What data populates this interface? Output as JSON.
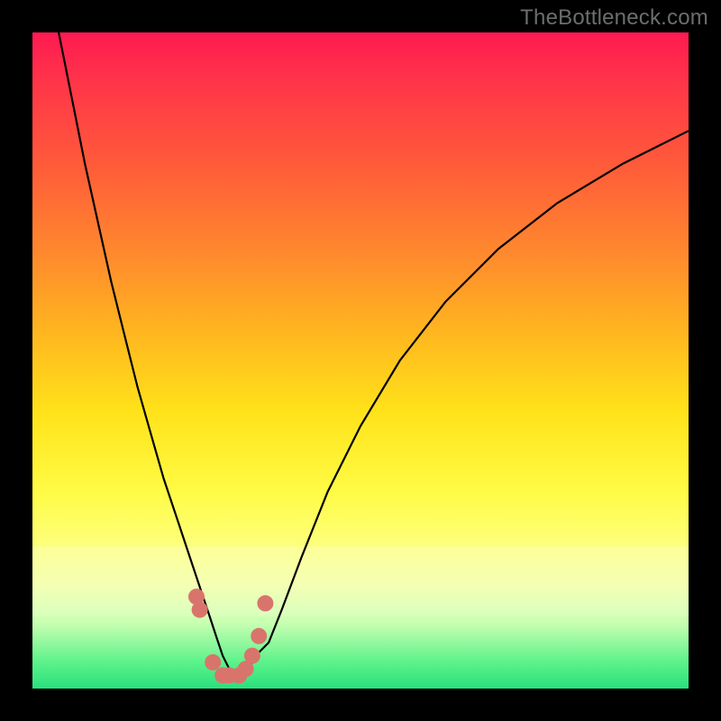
{
  "watermark": "TheBottleneck.com",
  "chart_data": {
    "type": "line",
    "title": "",
    "xlabel": "",
    "ylabel": "",
    "xlim": [
      0,
      100
    ],
    "ylim": [
      0,
      100
    ],
    "series": [
      {
        "name": "bottleneck-curve",
        "x": [
          4,
          6,
          8,
          10,
          12,
          14,
          16,
          18,
          20,
          22,
          24,
          26,
          27,
          28,
          29,
          30,
          31,
          32,
          33,
          34,
          36,
          38,
          41,
          45,
          50,
          56,
          63,
          71,
          80,
          90,
          100
        ],
        "values": [
          100,
          90,
          80,
          71,
          62,
          54,
          46,
          39,
          32,
          26,
          20,
          14,
          11,
          8,
          5,
          3,
          2,
          2,
          3,
          5,
          7,
          12,
          20,
          30,
          40,
          50,
          59,
          67,
          74,
          80,
          85
        ]
      }
    ],
    "markers": {
      "name": "sample-dots",
      "color": "#d9746c",
      "points": [
        {
          "x": 25.0,
          "y": 14
        },
        {
          "x": 25.5,
          "y": 12
        },
        {
          "x": 27.5,
          "y": 4
        },
        {
          "x": 29.0,
          "y": 2
        },
        {
          "x": 30.0,
          "y": 2
        },
        {
          "x": 31.5,
          "y": 2
        },
        {
          "x": 32.5,
          "y": 3
        },
        {
          "x": 33.5,
          "y": 5
        },
        {
          "x": 34.5,
          "y": 8
        },
        {
          "x": 35.5,
          "y": 13
        }
      ]
    },
    "gradient_stops": [
      {
        "pos": 0,
        "color": "#ff1a52"
      },
      {
        "pos": 50,
        "color": "#ffe31a"
      },
      {
        "pos": 100,
        "color": "#29e07c"
      }
    ]
  }
}
